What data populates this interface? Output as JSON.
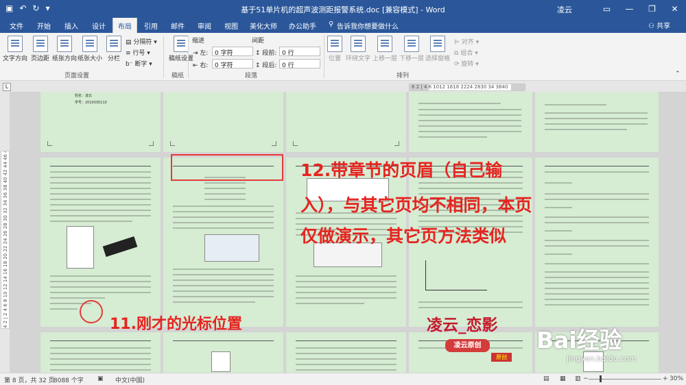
{
  "window": {
    "title": "基于51单片机的超声波测距报警系统.doc [兼容模式] - Word",
    "user": "凌云",
    "controls": [
      "▭",
      "—",
      "❐",
      "✕"
    ]
  },
  "tabs": [
    "文件",
    "开始",
    "插入",
    "设计",
    "布局",
    "引用",
    "邮件",
    "审阅",
    "视图",
    "美化大师",
    "办公助手"
  ],
  "active_tab": "布局",
  "tell_me": "告诉我你想要做什么",
  "share": "共享",
  "ribbon": {
    "page_setup": {
      "label": "页面设置",
      "buttons": [
        "文字方向",
        "页边距",
        "纸张方向",
        "纸张大小",
        "分栏"
      ],
      "small": [
        "分隔符",
        "行号",
        "断字"
      ]
    },
    "manuscript": {
      "label": "稿纸",
      "button": "稿纸设置"
    },
    "paragraph": {
      "label": "段落",
      "indent_title": "缩进",
      "spacing_title": "间距",
      "left_label": "左:",
      "right_label": "右:",
      "before_label": "段前:",
      "after_label": "段后:",
      "left_value": "0 字符",
      "right_value": "0 字符",
      "before_value": "0 行",
      "after_value": "0 行"
    },
    "arrange": {
      "label": "排列",
      "buttons": [
        "位置",
        "环绕文字",
        "上移一层",
        "下移一层",
        "选择窗格"
      ],
      "small": [
        "对齐",
        "组合",
        "旋转"
      ]
    }
  },
  "ruler": {
    "tab_selector": "L",
    "horizontal": "6  2  | 4 6  1012  1618  2224  2830  34  3840",
    "vertical": "4  2  | 2  4  6  8  10  12  14  16  18  20  22  24  26  28  30  32  34  36  38  40  42  44  46  48"
  },
  "document_fragments": {
    "page1_name": "姓名：凌云",
    "page1_id": "学号：2010030110"
  },
  "annotations": {
    "note12_line1": "12.带章节的页眉（自己输",
    "note12_line2": "入），与其它页均不相同，本页",
    "note12_line3": "仅做演示，其它页方法类似",
    "note11": "11.刚才的光标位置",
    "signature": "凌云_恋影",
    "stamp": "凌云原创",
    "stamp_small": "原创"
  },
  "watermark": {
    "brand": "Bai经验",
    "url": "jingyan.baidu.com"
  },
  "status": {
    "page": "第 8 页，共 32 页",
    "words": "8088 个字",
    "language": "中文(中国)",
    "zoom_minus": "−",
    "zoom_plus": "+",
    "zoom": "30%"
  },
  "colors": {
    "accent": "#2b579a",
    "page_background": "#d6ecd3",
    "annotation_red": "#e52420"
  }
}
